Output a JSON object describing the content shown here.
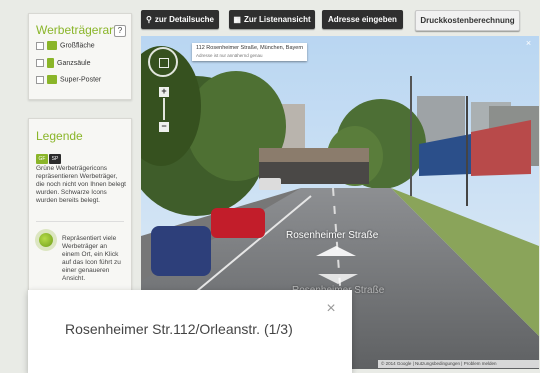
{
  "toolbar": {
    "detail_search": "zur Detailsuche",
    "list_view": "Zur Listenansicht",
    "enter_address": "Adresse eingeben",
    "print_costs": "Druckkostenberechnung"
  },
  "type_panel": {
    "title": "Werbeträgerart",
    "help": "?",
    "options": [
      "Großfläche",
      "Ganzsäule",
      "Super-Poster"
    ]
  },
  "legend": {
    "title": "Legende",
    "icon_labels": [
      "GF",
      "SP"
    ],
    "description": "Grüne Werbeträgericons repräsentieren Werbeträger, die noch nicht von Ihnen belegt wurden. Schwarze Icons wurden bereits belegt.",
    "cluster_text": "Repräsentiert viele Werbeträger an einem Ort, ein Klick auf das Icon führt zu einer genaueren Ansicht."
  },
  "streetview": {
    "address": "112 Rosenheimer Straße, München, Bayern",
    "address_note": "Adresse ist nur annähernd genau",
    "street_label": "Rosenheimer Straße",
    "street_label_2": "Rosenheimer Straße",
    "footer": "© 2014 Google | Nutzungsbedingungen | Problem melden",
    "zoom_in": "+",
    "zoom_out": "−",
    "close": "×"
  },
  "popup": {
    "title": "Rosenheimer Str.112/Orleanstr. (1/3)",
    "close": "×"
  },
  "colors": {
    "accent_green": "#8ab529",
    "toolbar_dark": "#2f2f2f"
  }
}
